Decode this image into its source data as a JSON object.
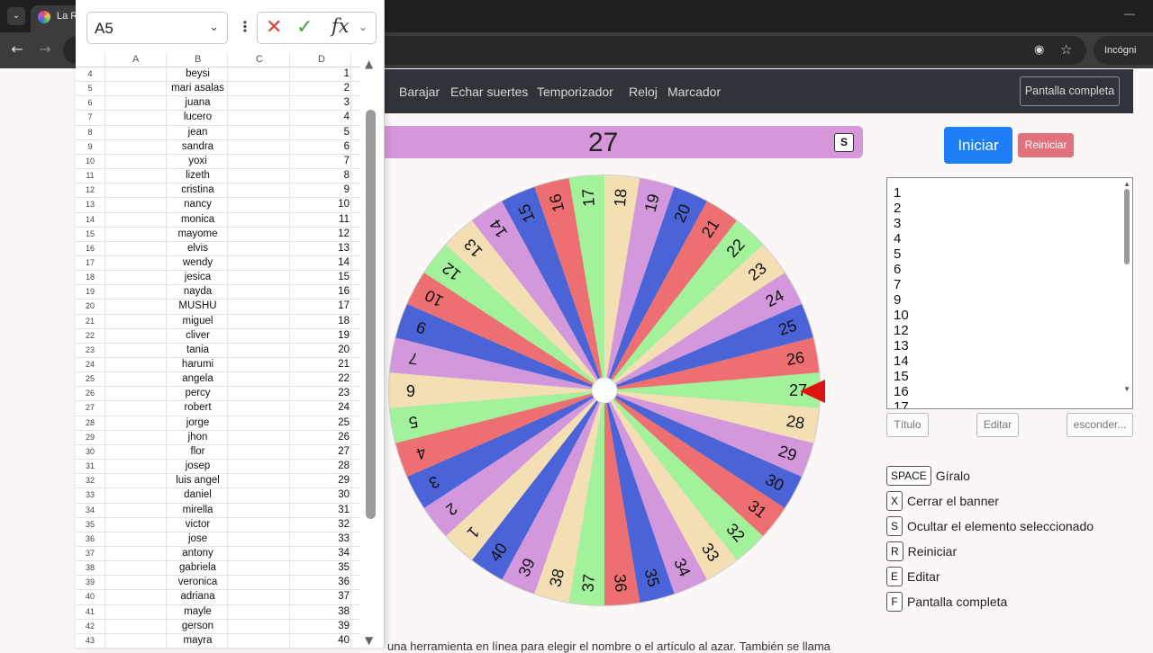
{
  "browser": {
    "tab_title": "La R",
    "tab_menu_icon": "chevron-down-icon",
    "incognito_label": "Incógni",
    "minimize_glyph": "—"
  },
  "nav": {
    "items": [
      "Barajar",
      "Echar suertes",
      "Temporizador",
      "Reloj",
      "Marcador"
    ],
    "fullscreen_label": "Pantalla completa"
  },
  "banner": {
    "result": "27",
    "hotkey": "S"
  },
  "wheel": {
    "numbers": [
      1,
      2,
      3,
      4,
      5,
      6,
      7,
      9,
      10,
      12,
      13,
      14,
      15,
      16,
      17,
      18,
      19,
      20,
      21,
      22,
      23,
      24,
      25,
      26,
      27,
      28,
      29,
      30,
      31,
      32,
      33,
      34,
      35,
      36,
      37,
      38,
      39,
      40
    ],
    "colors": [
      "#4a63d6",
      "#ee6f72",
      "#a1f29a",
      "#f4deb4",
      "#d398dc"
    ],
    "pointer_color": "#e01212"
  },
  "controls": {
    "start_label": "Iniciar",
    "reset_label": "Reiniciar",
    "entries": [
      "1",
      "2",
      "3",
      "4",
      "5",
      "6",
      "7",
      "9",
      "10",
      "12",
      "13",
      "14",
      "15",
      "16",
      "17"
    ],
    "title_btn": "Título",
    "edit_btn": "Editar",
    "hide_btn": "esconder..."
  },
  "shortcuts": [
    {
      "key": "SPACE",
      "text": "Gíralo"
    },
    {
      "key": "X",
      "text": "Cerrar el banner"
    },
    {
      "key": "S",
      "text": "Ocultar el elemento seleccionado"
    },
    {
      "key": "R",
      "text": "Reiniciar"
    },
    {
      "key": "E",
      "text": "Editar"
    },
    {
      "key": "F",
      "text": "Pantalla completa"
    }
  ],
  "footer_text": "una herramienta en línea para elegir el nombre o el artículo al azar. También se llama",
  "sheet": {
    "namebox": "A5",
    "columns": [
      "A",
      "B",
      "C",
      "D"
    ],
    "rows": [
      {
        "r": "4",
        "name": "beysi",
        "n": "1"
      },
      {
        "r": "5",
        "name": "mari asalas",
        "n": "2"
      },
      {
        "r": "6",
        "name": "juana",
        "n": "3"
      },
      {
        "r": "7",
        "name": "lucero",
        "n": "4"
      },
      {
        "r": "8",
        "name": "jean",
        "n": "5"
      },
      {
        "r": "9",
        "name": "sandra",
        "n": "6"
      },
      {
        "r": "10",
        "name": "yoxi",
        "n": "7"
      },
      {
        "r": "11",
        "name": "lizeth",
        "n": "8"
      },
      {
        "r": "12",
        "name": "cristina",
        "n": "9"
      },
      {
        "r": "13",
        "name": "nancy",
        "n": "10"
      },
      {
        "r": "14",
        "name": "monica",
        "n": "11"
      },
      {
        "r": "15",
        "name": "mayome",
        "n": "12"
      },
      {
        "r": "16",
        "name": "elvis",
        "n": "13"
      },
      {
        "r": "17",
        "name": "wendy",
        "n": "14"
      },
      {
        "r": "18",
        "name": "jesica",
        "n": "15"
      },
      {
        "r": "19",
        "name": "nayda",
        "n": "16"
      },
      {
        "r": "20",
        "name": "MUSHU",
        "n": "17"
      },
      {
        "r": "21",
        "name": "miguel",
        "n": "18"
      },
      {
        "r": "22",
        "name": "cliver",
        "n": "19"
      },
      {
        "r": "23",
        "name": "tania",
        "n": "20"
      },
      {
        "r": "24",
        "name": "harumi",
        "n": "21"
      },
      {
        "r": "25",
        "name": "angela",
        "n": "22"
      },
      {
        "r": "26",
        "name": "percy",
        "n": "23"
      },
      {
        "r": "27",
        "name": "robert",
        "n": "24"
      },
      {
        "r": "28",
        "name": "jorge",
        "n": "25"
      },
      {
        "r": "29",
        "name": "jhon",
        "n": "26"
      },
      {
        "r": "30",
        "name": "flor",
        "n": "27"
      },
      {
        "r": "31",
        "name": "josep",
        "n": "28"
      },
      {
        "r": "32",
        "name": "luis angel",
        "n": "29"
      },
      {
        "r": "33",
        "name": "daniel",
        "n": "30"
      },
      {
        "r": "34",
        "name": "mirella",
        "n": "31"
      },
      {
        "r": "35",
        "name": "victor",
        "n": "32"
      },
      {
        "r": "36",
        "name": "jose",
        "n": "33"
      },
      {
        "r": "37",
        "name": "antony",
        "n": "34"
      },
      {
        "r": "38",
        "name": "gabriela",
        "n": "35"
      },
      {
        "r": "39",
        "name": "veronica",
        "n": "36"
      },
      {
        "r": "40",
        "name": "adriana",
        "n": "37"
      },
      {
        "r": "41",
        "name": "mayle",
        "n": "38"
      },
      {
        "r": "42",
        "name": "gerson",
        "n": "39"
      },
      {
        "r": "43",
        "name": "mayra",
        "n": "40"
      }
    ]
  }
}
